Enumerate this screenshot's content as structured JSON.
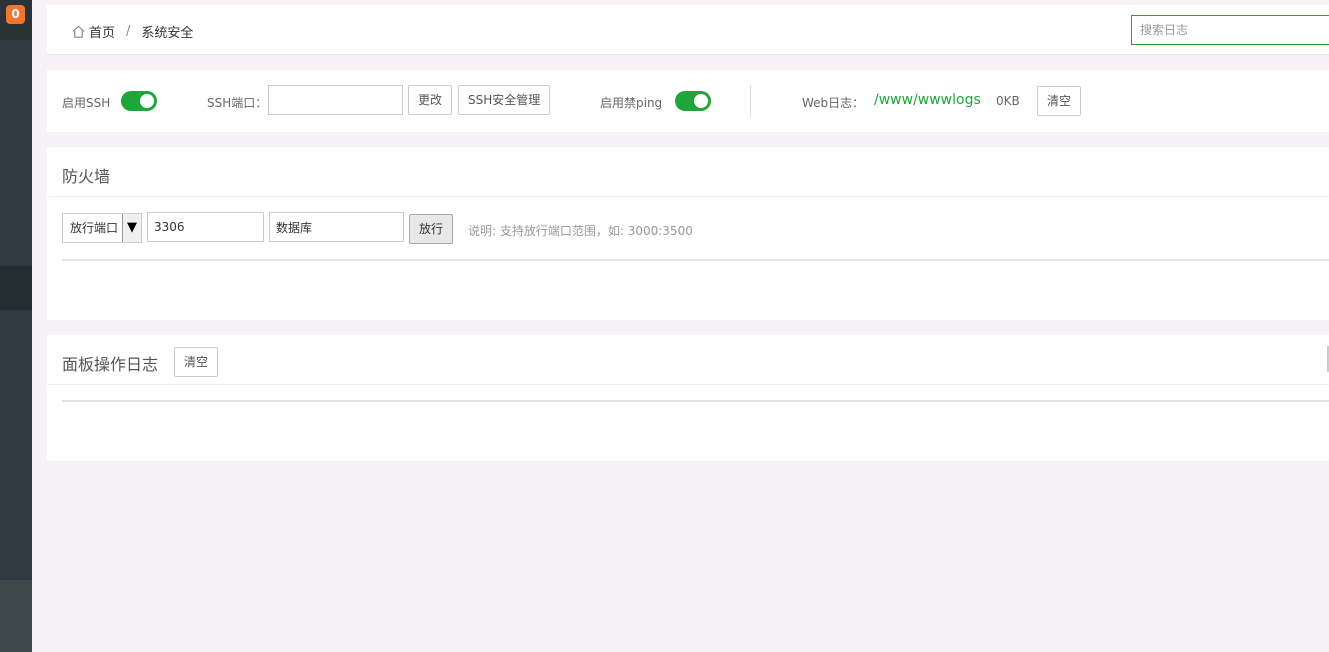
{
  "sidebar": {
    "badge_count": "0"
  },
  "breadcrumb": {
    "home": "首页",
    "separator": "/",
    "current": "系统安全"
  },
  "search": {
    "placeholder": "搜索日志"
  },
  "settings": {
    "ssh_label": "启用SSH",
    "ssh_enabled": true,
    "ssh_port_label": "SSH端口：",
    "ssh_port_value": "",
    "change_button": "更改",
    "ssh_manage_button": "SSH安全管理",
    "ping_label": "启用禁ping",
    "ping_enabled": true,
    "web_log_label": "Web日志：",
    "web_log_path": "/www/wwwlogs",
    "web_log_size": "0KB",
    "clear_button": "清空"
  },
  "firewall": {
    "title": "防火墙",
    "type_selected": "放行端口",
    "port_value": "3306",
    "remark_value": "数据库",
    "allow_button": "放行",
    "note": "说明: 支持放行端口范围，如: 3000:3500"
  },
  "oplog": {
    "title": "面板操作日志",
    "clear_button": "清空"
  },
  "colors": {
    "accent": "#20a53a",
    "badge": "#f2762e",
    "sidebar": "#2f3b40"
  }
}
